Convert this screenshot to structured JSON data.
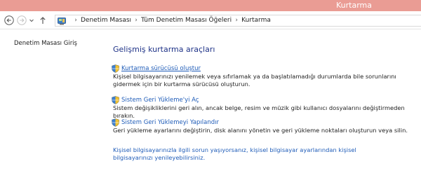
{
  "window": {
    "title": "Kurtarma",
    "accent_color": "#ea9c94"
  },
  "navigation": {
    "back_icon": "arrow-left-icon",
    "forward_icon": "arrow-right-icon",
    "history_icon": "chevron-down-icon",
    "up_icon": "arrow-up-icon"
  },
  "address_bar": {
    "icon": "control-panel-icon",
    "breadcrumbs": [
      "Denetim Masası",
      "Tüm Denetim Masası Öğeleri",
      "Kurtarma"
    ]
  },
  "sidebar": {
    "home_label": "Denetim Masası Giriş"
  },
  "main": {
    "heading": "Gelişmiş kurtarma araçları",
    "items": [
      {
        "title": "Kurtarma sürücüsü oluştur",
        "description": "Kişisel bilgisayarınızı yenilemek veya sıfırlamak ya da başlatılamadığı durumlarda bile sorunlarını gidermek için bir kurtarma sürücüsü oluşturun.",
        "icon": "shield-icon"
      },
      {
        "title": "Sistem Geri Yükleme'yi Aç",
        "description": "Sistem değişikliklerini geri alın, ancak belge, resim ve müzik gibi kullanıcı dosyalarını değiştirmeden bırakın.",
        "icon": "shield-icon"
      },
      {
        "title": "Sistem Geri Yüklemeyi Yapılandır",
        "description": "Geri yükleme ayarlarını değiştirin, disk alanını yönetin ve geri yükleme noktaları oluşturun veya silin.",
        "icon": "shield-icon"
      }
    ],
    "footer_link": "Kişisel bilgisayarınızla ilgili sorun yaşıyorsanız, kişisel bilgisayar ayarlarından kişisel bilgisayarınızı yenileyebilirsiniz."
  }
}
